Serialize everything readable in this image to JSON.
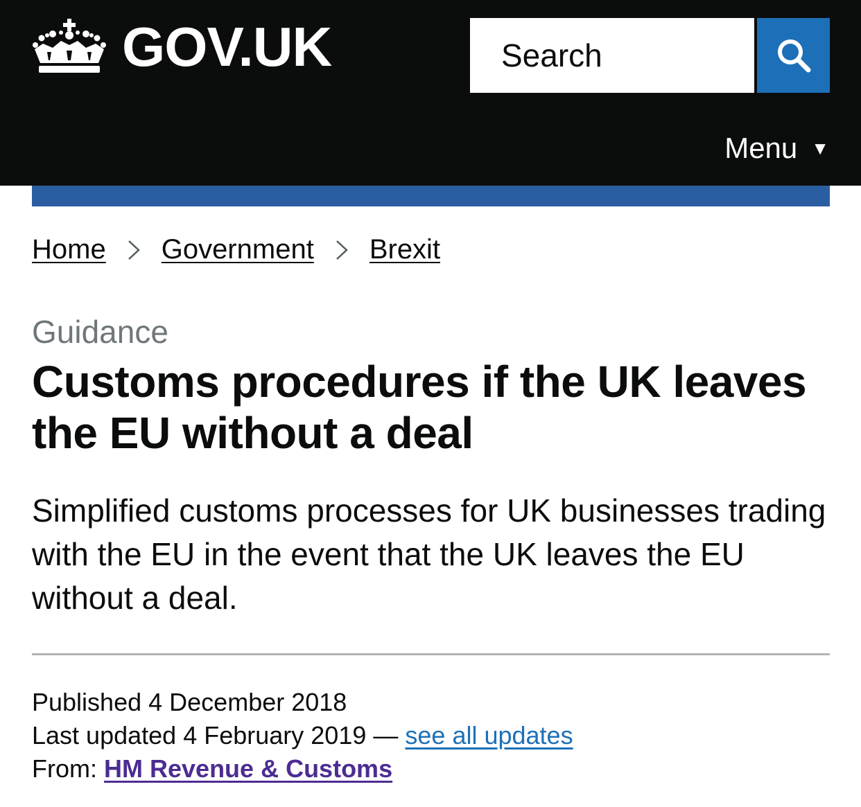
{
  "header": {
    "logo_text": "GOV.UK",
    "search": {
      "placeholder": "Search"
    },
    "menu_label": "Menu",
    "menu_arrow": "▼",
    "icons": {
      "logo": "crown-icon",
      "search": "search-icon"
    },
    "colors": {
      "background": "#0b0c0c",
      "search_button": "#1d70b8",
      "accent_bar": "#2b5ea0"
    }
  },
  "breadcrumb": [
    "Home",
    "Government",
    "Brexit"
  ],
  "main": {
    "caption": "Guidance",
    "title": "Customs procedures if the UK leaves the EU without a deal",
    "lede": "Simplified customs processes for UK businesses trading with the EU in the event that the UK leaves the EU without a deal."
  },
  "metadata": {
    "published_label": "Published",
    "published_date": "4 December 2018",
    "updated_label": "Last updated",
    "updated_date": "4 February 2019",
    "separator": "—",
    "updates_link": "see all updates",
    "from_label": "From:",
    "from_org": "HM Revenue & Customs"
  }
}
